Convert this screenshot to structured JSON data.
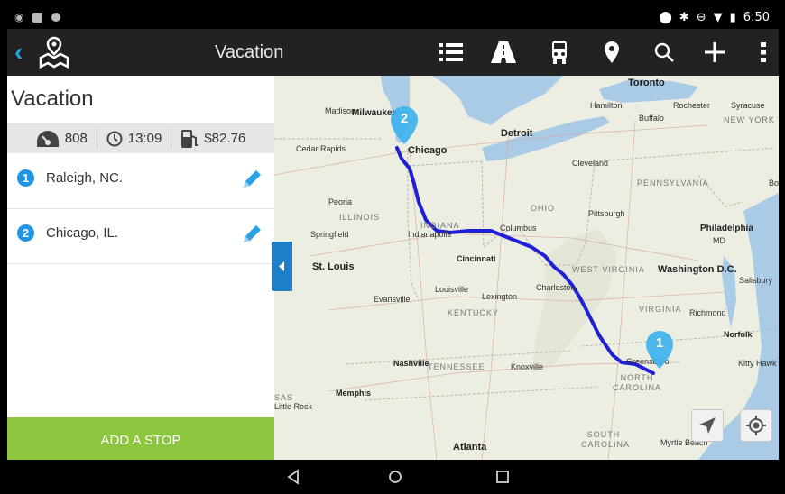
{
  "status_bar": {
    "time": "6:50",
    "icons": [
      "android-icon",
      "image-icon",
      "circle-icon",
      "location-icon",
      "bluetooth-icon",
      "minus-circle-icon",
      "wifi-icon",
      "battery-icon"
    ]
  },
  "app_bar": {
    "title": "Vacation",
    "icons": [
      "back-icon",
      "map-pin-logo-icon",
      "list-icon",
      "road-icon",
      "truck-icon",
      "place-icon",
      "search-icon",
      "add-icon",
      "overflow-icon"
    ]
  },
  "trip": {
    "title": "Vacation",
    "stats": {
      "distance": "808",
      "duration": "13:09",
      "fuel_cost": "$82.76"
    },
    "stops": [
      {
        "number": "1",
        "label": "Raleigh, NC."
      },
      {
        "number": "2",
        "label": "Chicago, IL."
      }
    ],
    "add_stop_label": "ADD A STOP"
  },
  "map": {
    "labels": {
      "toronto": "Toronto",
      "hamilton": "Hamilton",
      "rochester": "Rochester",
      "syracuse": "Syracuse",
      "buffalo": "Buffalo",
      "new_york": "NEW YORK",
      "madison": "Madison",
      "milwaukee": "Milwaukee",
      "detroit": "Detroit",
      "cedar_rapids": "Cedar Rapids",
      "chicago": "Chicago",
      "cleveland": "Cleveland",
      "pennsylvania": "PENNSYLVANIA",
      "peoria": "Peoria",
      "illinois": "ILLINOIS",
      "ohio": "OHIO",
      "pittsburgh": "Pittsburgh",
      "springfield": "Springfield",
      "indiana": "INDIANA",
      "indianapolis": "Indianapolis",
      "columbus": "Columbus",
      "philadelphia": "Philadelphia",
      "md": "MD",
      "st_louis": "St. Louis",
      "cincinnati": "Cincinnati",
      "west_virginia": "WEST VIRGINIA",
      "washington_dc": "Washington D.C.",
      "evansville": "Evansville",
      "louisville": "Louisville",
      "lexington": "Lexington",
      "charleston": "Charleston",
      "salisbury": "Salisbury",
      "kentucky": "KENTUCKY",
      "virginia": "VIRGINIA",
      "richmond": "Richmond",
      "norfolk": "Norfolk",
      "nashville": "Nashville",
      "tennessee": "TENNESSEE",
      "knoxville": "Knoxville",
      "greensboro": "Greensboro",
      "north_carolina": "NORTH CAROLINA",
      "kitty_hawk": "Kitty Hawk",
      "memphis": "Memphis",
      "little_rock": "Little Rock",
      "sas": "SAS",
      "south_carolina": "SOUTH CAROLINA",
      "atlanta": "Atlanta",
      "myrtle_beach": "Myrtle Beach",
      "bos": "Bos"
    },
    "markers": [
      {
        "number": "1"
      },
      {
        "number": "2"
      }
    ],
    "route_color": "#1f1fd8"
  },
  "colors": {
    "accent": "#1f95e6",
    "add_stop_bg": "#8cc63f",
    "app_bar_bg": "#222222"
  }
}
